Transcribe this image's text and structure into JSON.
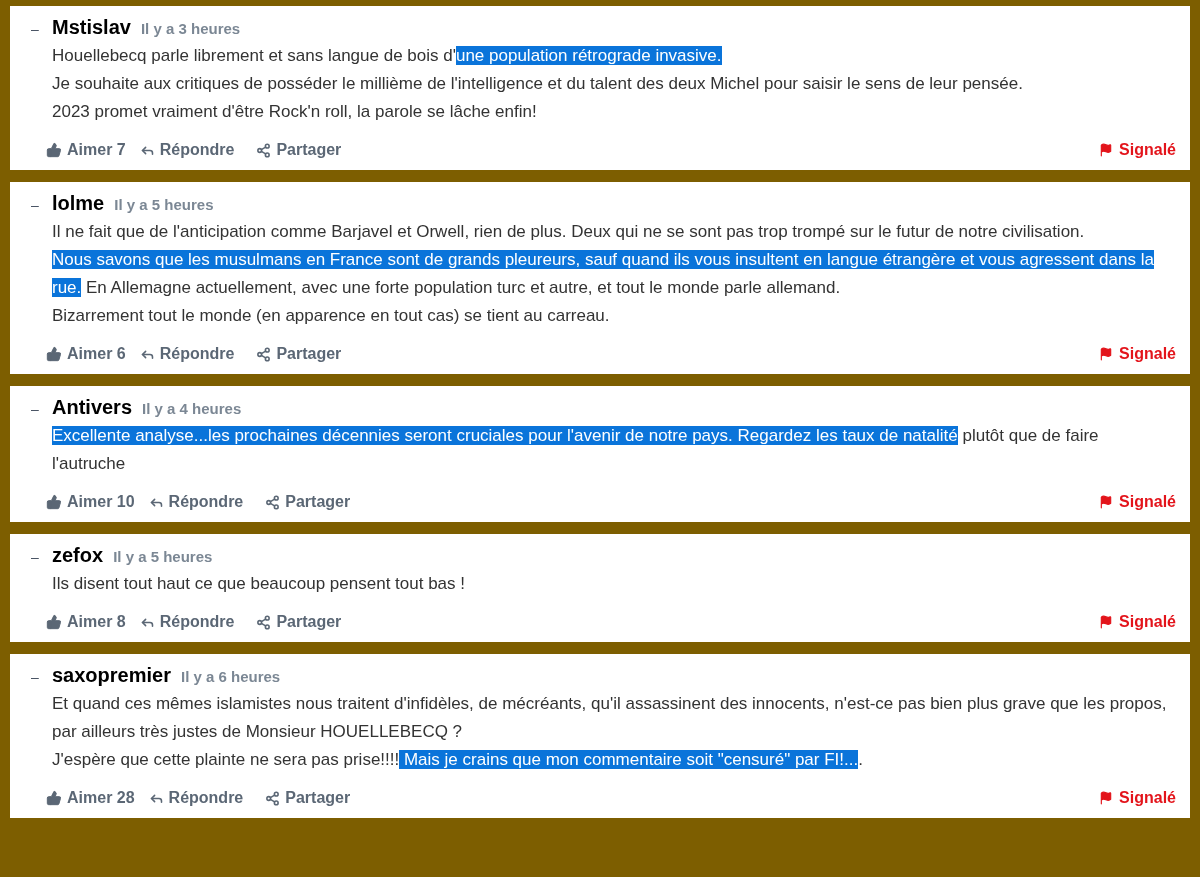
{
  "comments": [
    {
      "collapse": "–",
      "author": "Mstislav",
      "time": "Il y a 3 heures",
      "paragraphs": [
        [
          {
            "text": "Houellebecq parle librement et sans langue de bois d'",
            "highlighted": false
          },
          {
            "text": "une population rétrograde invasive.",
            "highlighted": true
          }
        ],
        [
          {
            "text": "Je souhaite aux critiques de posséder le millième de l'intelligence et du talent des deux Michel pour saisir le sens de leur pensée.",
            "highlighted": false
          }
        ],
        [
          {
            "text": "2023 promet vraiment d'être Rock'n roll, la parole se lâche enfin!",
            "highlighted": false
          }
        ]
      ],
      "like": "Aimer 7",
      "reply": "Répondre",
      "share": "Partager",
      "report": "Signalé",
      "reported": true
    },
    {
      "collapse": "–",
      "author": "lolme",
      "time": "Il y a 5 heures",
      "paragraphs": [
        [
          {
            "text": "Il ne fait que de l'anticipation comme Barjavel et Orwell, rien de plus. Deux qui ne se sont pas trop trompé sur le futur de notre civilisation.",
            "highlighted": false
          }
        ],
        [
          {
            "text": "Nous savons que les musulmans en France sont de grands pleureurs, sauf quand ils vous insultent en langue étrangère et vous agressent dans la rue.",
            "highlighted": true
          },
          {
            "text": " En Allemagne actuellement, avec une forte population turc et autre, et tout le monde parle allemand.",
            "highlighted": false
          }
        ],
        [
          {
            "text": "Bizarrement tout le monde (en apparence en tout cas) se tient au carreau.",
            "highlighted": false
          }
        ]
      ],
      "like": "Aimer 6",
      "reply": "Répondre",
      "share": "Partager",
      "report": "Signalé",
      "reported": true
    },
    {
      "collapse": "–",
      "author": "Antivers",
      "time": "Il y a 4 heures",
      "paragraphs": [
        [
          {
            "text": "Excellente analyse...les prochaines décennies seront cruciales pour l'avenir de notre pays. Regardez les taux de natalité",
            "highlighted": true
          },
          {
            "text": " plutôt que de faire l'autruche",
            "highlighted": false
          }
        ]
      ],
      "like": "Aimer 10",
      "reply": "Répondre",
      "share": "Partager",
      "report": "Signalé",
      "reported": true
    },
    {
      "collapse": "–",
      "author": "zefox",
      "time": "Il y a 5 heures",
      "paragraphs": [
        [
          {
            "text": "Ils disent tout haut ce que beaucoup pensent tout bas !",
            "highlighted": false
          }
        ]
      ],
      "like": "Aimer 8",
      "reply": "Répondre",
      "share": "Partager",
      "report": "Signalé",
      "reported": true
    },
    {
      "collapse": "–",
      "author": "saxopremier",
      "time": "Il y a 6 heures",
      "paragraphs": [
        [
          {
            "text": "Et quand ces mêmes islamistes nous traitent d'infidèles, de mécréants, qu'il assassinent des innocents, n'est-ce pas bien plus grave que les propos, par ailleurs très justes de Monsieur HOUELLEBECQ ?",
            "highlighted": false
          }
        ],
        [
          {
            "text": "J'espère que cette plainte ne sera pas prise!!!!",
            "highlighted": false
          },
          {
            "text": " Mais je crains que mon commentaire soit \"censuré\" par FI!...",
            "highlighted": true
          },
          {
            "text": ".",
            "highlighted": false
          }
        ]
      ],
      "like": "Aimer 28",
      "reply": "Répondre",
      "share": "Partager",
      "report": "Signalé",
      "reported": true
    }
  ]
}
